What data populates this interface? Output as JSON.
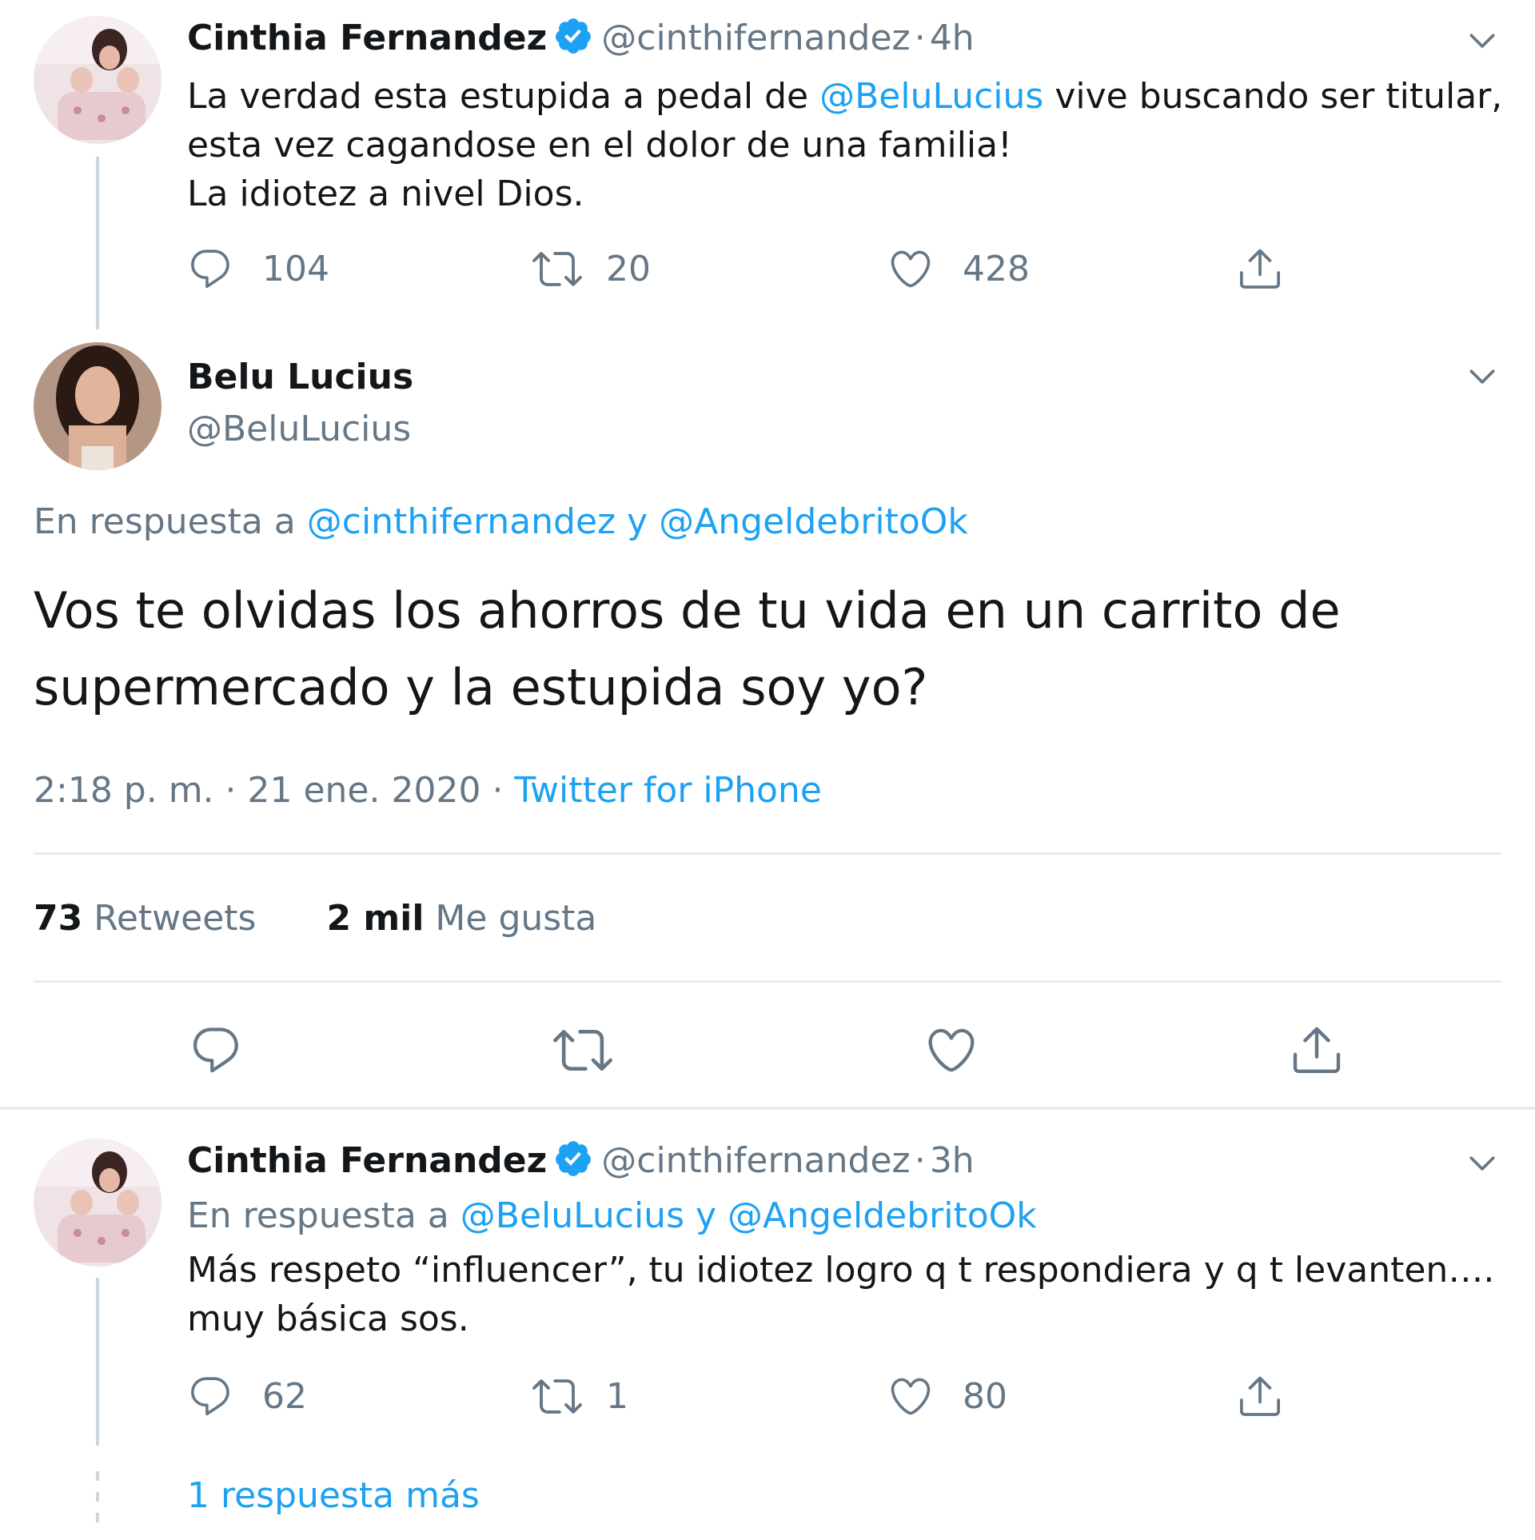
{
  "tweets": [
    {
      "name": "Cinthia Fernandez",
      "handle": "@cinthifernandez",
      "sep": "·",
      "time": "4h",
      "body": {
        "pre": "La verdad esta estupida a pedal de ",
        "mention": "@BeluLucius",
        "post": " vive buscando ser titular,",
        "line2": "esta vez cagandose en el dolor de una familia!",
        "line3": "La idiotez a nivel Dios."
      },
      "replies": "104",
      "retweets": "20",
      "likes": "428"
    }
  ],
  "main_tweet": {
    "name": "Belu Lucius",
    "handle": "@BeluLucius",
    "reply_prefix": "En respuesta a ",
    "reply_to_1": "@cinthifernandez",
    "reply_and": " y ",
    "reply_to_2": "@AngeldebritoOk",
    "line1": "Vos te olvidas los ahorros de tu vida en un carrito de",
    "line2": "supermercado y la estupida soy yo?",
    "timestamp": "2:18 p. m. · 21 ene. 2020 · ",
    "source": "Twitter for iPhone",
    "retweets_count": "73",
    "retweets_label": "Retweets",
    "likes_count": "2 mil",
    "likes_label": "Me gusta"
  },
  "reply_tweet": {
    "name": "Cinthia Fernandez",
    "handle": "@cinthifernandez",
    "sep": "·",
    "time": "3h",
    "reply_prefix": "En respuesta a ",
    "reply_to_1": "@BeluLucius",
    "reply_and": " y ",
    "reply_to_2": "@AngeldebritoOk",
    "line1": "Más respeto “influencer”, tu idiotez logro q t respondiera y q t levanten….",
    "line2": "muy básica sos.",
    "replies": "62",
    "retweets": "1",
    "likes": "80"
  },
  "more_replies": "1 respuesta más",
  "colors": {
    "accent": "#1da1f2",
    "muted": "#657786",
    "text": "#14171a",
    "divider": "#e6ecf0"
  }
}
